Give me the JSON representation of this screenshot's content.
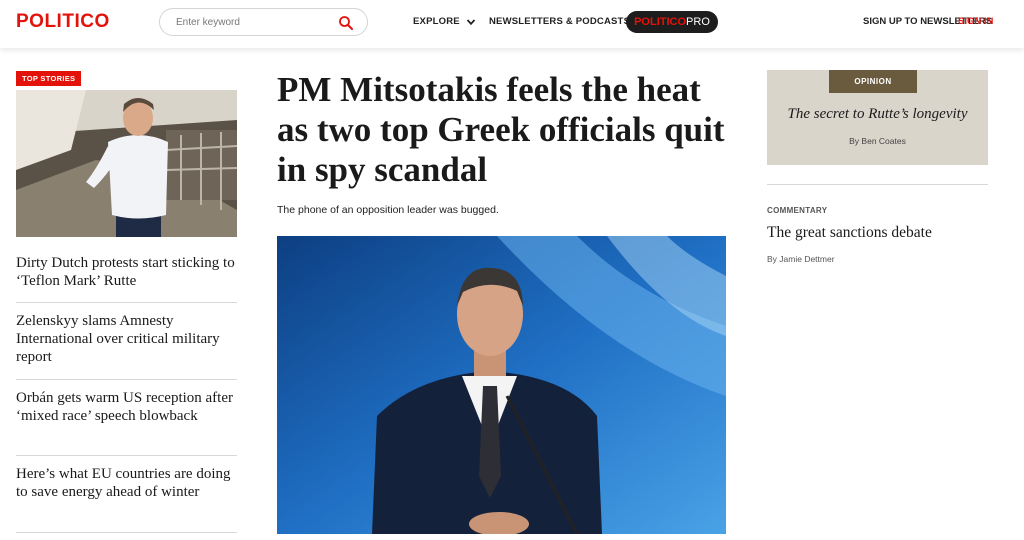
{
  "header": {
    "logo": "POLITICO",
    "search_placeholder": "Enter keyword",
    "nav_explore": "EXPLORE",
    "nav_newsletters": "NEWSLETTERS & PODCASTS",
    "pro_part1": "POLITICO",
    "pro_part2": "PRO",
    "signup": "SIGN UP TO NEWSLETTERS",
    "signin": "SIGN IN"
  },
  "left": {
    "badge": "TOP STORIES",
    "stories": [
      "Dirty Dutch protests start sticking to ‘Teflon Mark’ Rutte",
      "Zelenskyy slams Amnesty International over critical military report",
      "Orbán gets warm US reception after ‘mixed race’ speech blowback",
      "Here’s what EU countries are doing to save energy ahead of winter"
    ]
  },
  "main": {
    "headline": "PM Mitsotakis feels the heat as two top Greek officials quit in spy scandal",
    "dek": "The phone of an opposition leader was bugged."
  },
  "right": {
    "opinion_tag": "OPINION",
    "opinion_title": "The secret to Rutte’s longevity",
    "opinion_byline": "By Ben Coates",
    "commentary_tag": "COMMENTARY",
    "commentary_title": "The great sanctions debate",
    "commentary_byline": "By Jamie Dettmer"
  },
  "colors": {
    "brand_red": "#e3120b",
    "opinion_bg": "#d9d5cb",
    "opinion_tag_bg": "#6a5a3e"
  },
  "icons": [
    "search-icon",
    "chevron-down-icon"
  ]
}
